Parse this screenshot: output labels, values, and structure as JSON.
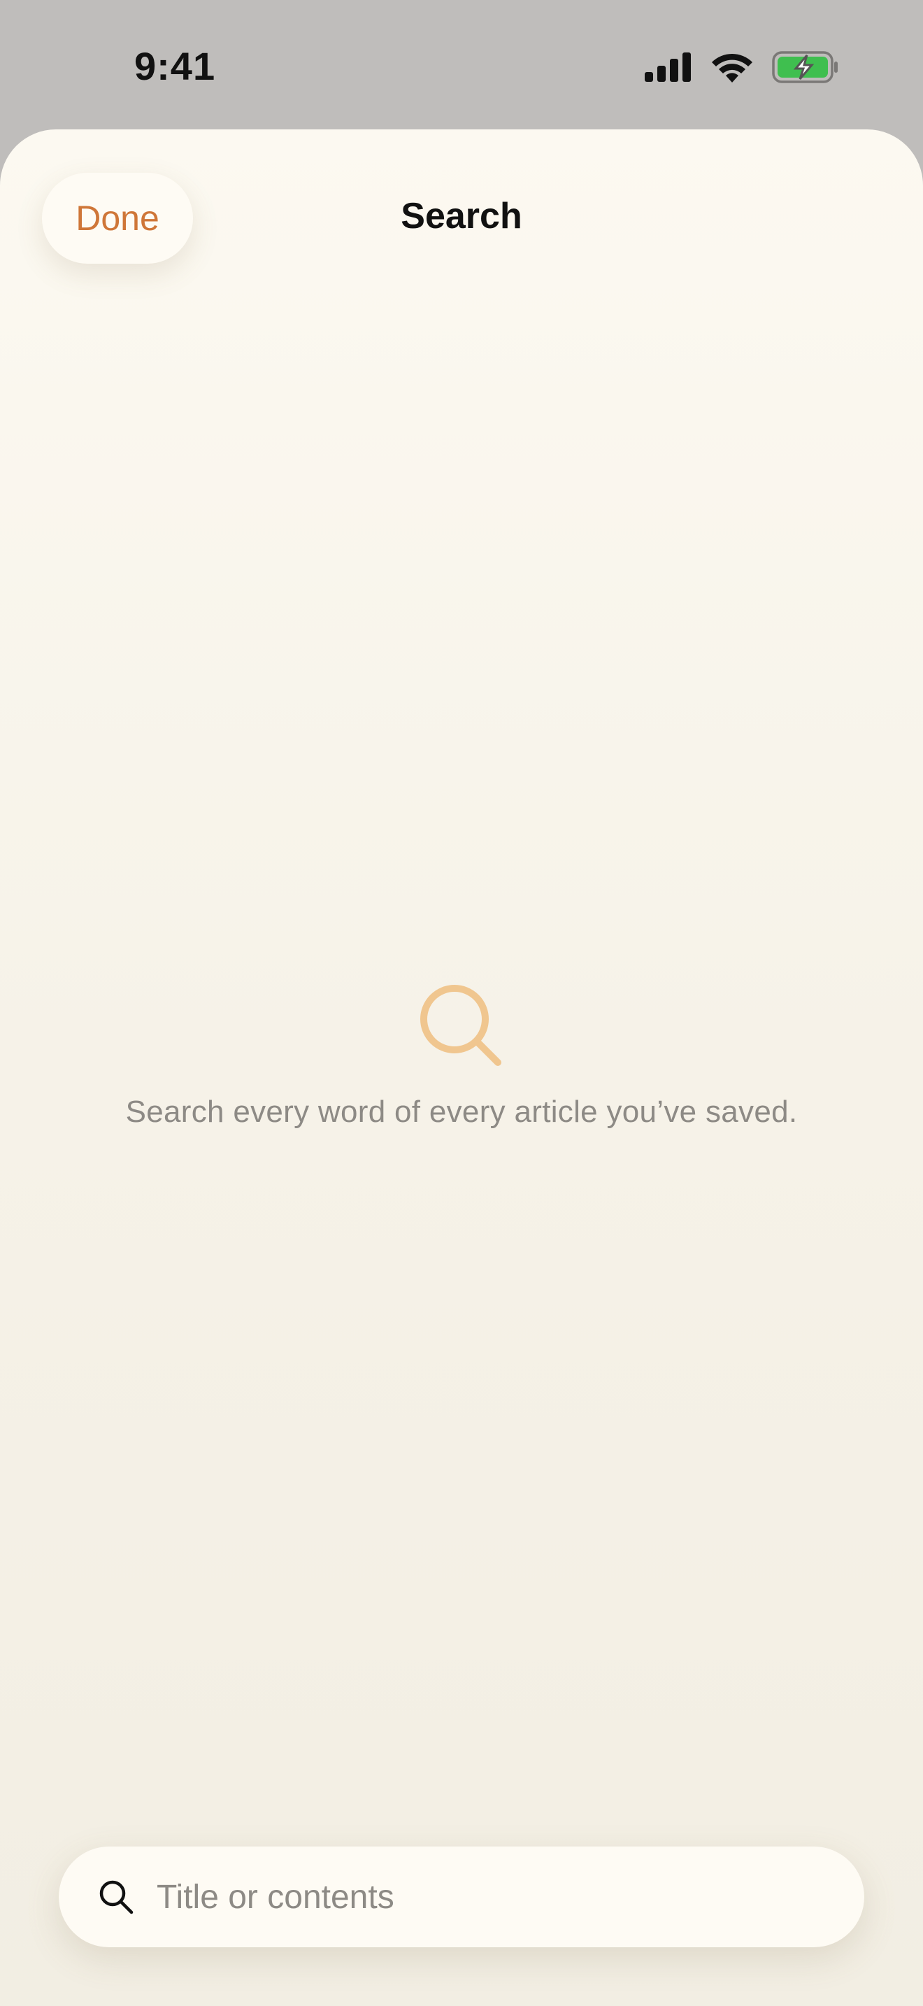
{
  "status_bar": {
    "time": "9:41",
    "icons": [
      "signal-icon",
      "wifi-icon",
      "battery-charging-icon"
    ]
  },
  "sheet": {
    "done_label": "Done",
    "title": "Search"
  },
  "empty_state": {
    "icon": "search-icon",
    "message": "Search every word of every article you’ve saved."
  },
  "search": {
    "icon": "search-icon",
    "value": "",
    "placeholder": "Title or contents"
  },
  "colors": {
    "accent": "#cf7638",
    "empty_icon": "#f0c68f",
    "battery_fill": "#3fbf4f",
    "sheet_background": "#f7f3ea",
    "status_background": "#bfbdbb",
    "secondary_text": "#8d8a85"
  }
}
